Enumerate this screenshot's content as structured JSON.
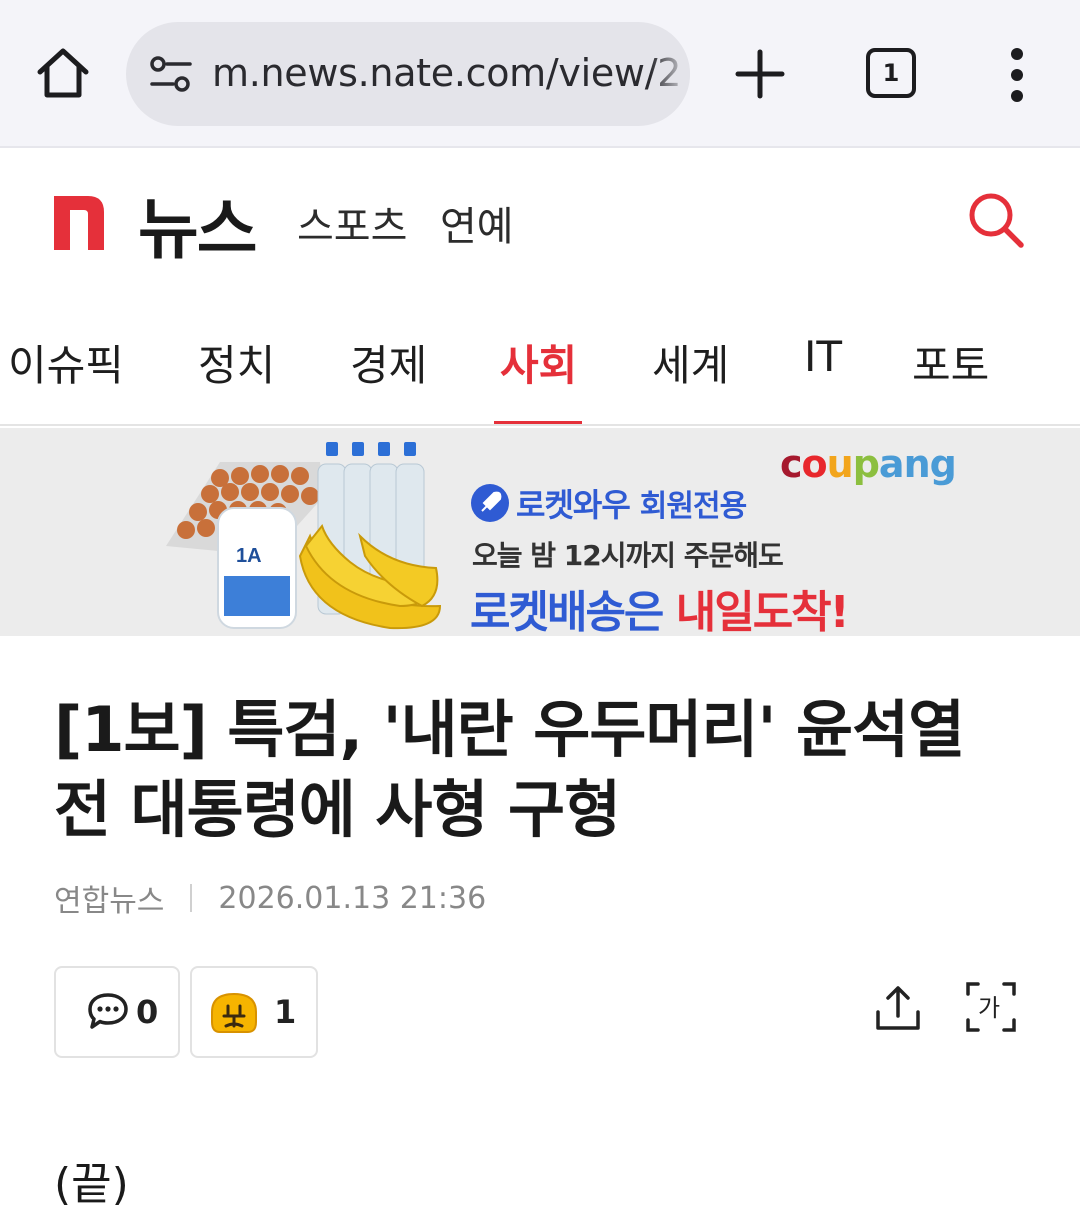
{
  "browser": {
    "url": "m.news.nate.com/view/2",
    "tab_count": "1",
    "icons": [
      "home-icon",
      "site-settings-icon",
      "plus-icon",
      "tab-switcher-icon",
      "more-vert-icon"
    ]
  },
  "header": {
    "logo_text": "뉴스",
    "links": [
      "스포츠",
      "연예"
    ],
    "accent_color": "#e5303a"
  },
  "nav": {
    "categories": [
      {
        "label": "이슈픽"
      },
      {
        "label": "정치"
      },
      {
        "label": "경제"
      },
      {
        "label": "사회",
        "active": true
      },
      {
        "label": "세계"
      },
      {
        "label": "IT"
      },
      {
        "label": "포토"
      }
    ]
  },
  "ad": {
    "brand": "coupang",
    "badge": "로켓와우",
    "badge_sub": "회원전용",
    "line1": "오늘 밤 12시까지 주문해도",
    "line2_blue": "로켓배송은",
    "line2_red": "내일도착!",
    "product_label": "1A"
  },
  "article": {
    "headline": "[1보] 특검, '내란 우두머리' 윤석열 전 대통령에 사형 구형",
    "source": "연합뉴스",
    "datetime": "2026.01.13 21:36",
    "comment_count": "0",
    "reaction_count": "1",
    "body_end": "(끝)"
  }
}
